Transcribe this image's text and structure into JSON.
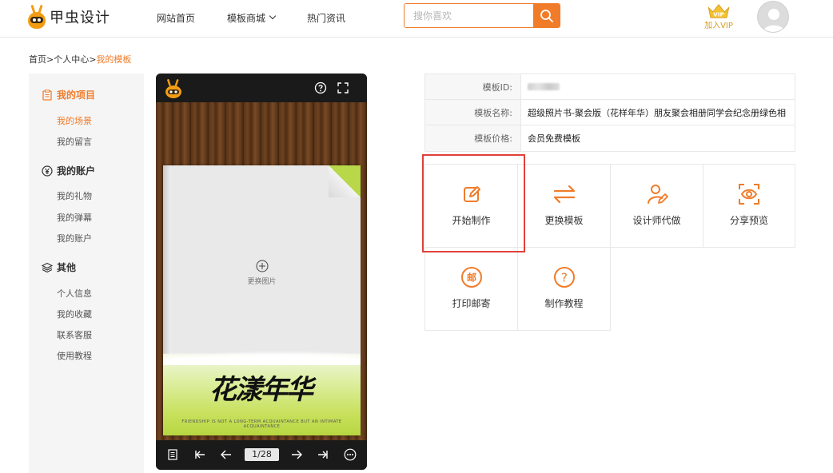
{
  "header": {
    "logo_text": "甲虫设计",
    "nav": [
      {
        "label": "网站首页"
      },
      {
        "label": "模板商城"
      },
      {
        "label": "热门资讯"
      }
    ],
    "search": {
      "placeholder": "搜你喜欢"
    },
    "vip_label": "加入VIP",
    "vip_badge": "VIP"
  },
  "breadcrumb": {
    "home": "首页",
    "sep1": ">",
    "center": "个人中心",
    "sep2": ">",
    "current": "我的模板"
  },
  "sidebar": {
    "groups": [
      {
        "title": "我的项目",
        "items": [
          "我的场景",
          "我的留言"
        ]
      },
      {
        "title": "我的账户",
        "items": [
          "我的礼物",
          "我的弹幕",
          "我的账户"
        ]
      },
      {
        "title": "其他",
        "items": [
          "个人信息",
          "我的收藏",
          "联系客服",
          "使用教程"
        ]
      }
    ]
  },
  "preview": {
    "replace_label": "更换图片",
    "book_title": "花漾年华",
    "tiny_text": "FRIENDSHIP IS NOT A LONG-TERM ACQUAINTANCE BUT AN INTIMATE ACQUAINTANCE",
    "page_indicator": "1/28"
  },
  "info": {
    "rows": [
      {
        "key": "模板ID:",
        "value": ""
      },
      {
        "key": "模板名称:",
        "value": "超级照片书-聚会版（花样年华）朋友聚会相册同学会纪念册绿色相"
      },
      {
        "key": "模板价格:",
        "value": "会员免费模板"
      }
    ]
  },
  "actions": [
    {
      "label": "开始制作",
      "icon": "edit-icon"
    },
    {
      "label": "更换模板",
      "icon": "swap-icon"
    },
    {
      "label": "设计师代做",
      "icon": "designer-icon"
    },
    {
      "label": "分享预览",
      "icon": "eye-icon"
    },
    {
      "label": "打印邮寄",
      "icon": "mail-icon",
      "glyph": "邮"
    },
    {
      "label": "制作教程",
      "icon": "help-icon",
      "glyph": "?"
    }
  ],
  "colors": {
    "accent": "#f07c2a",
    "highlight_border": "#e0403a"
  }
}
